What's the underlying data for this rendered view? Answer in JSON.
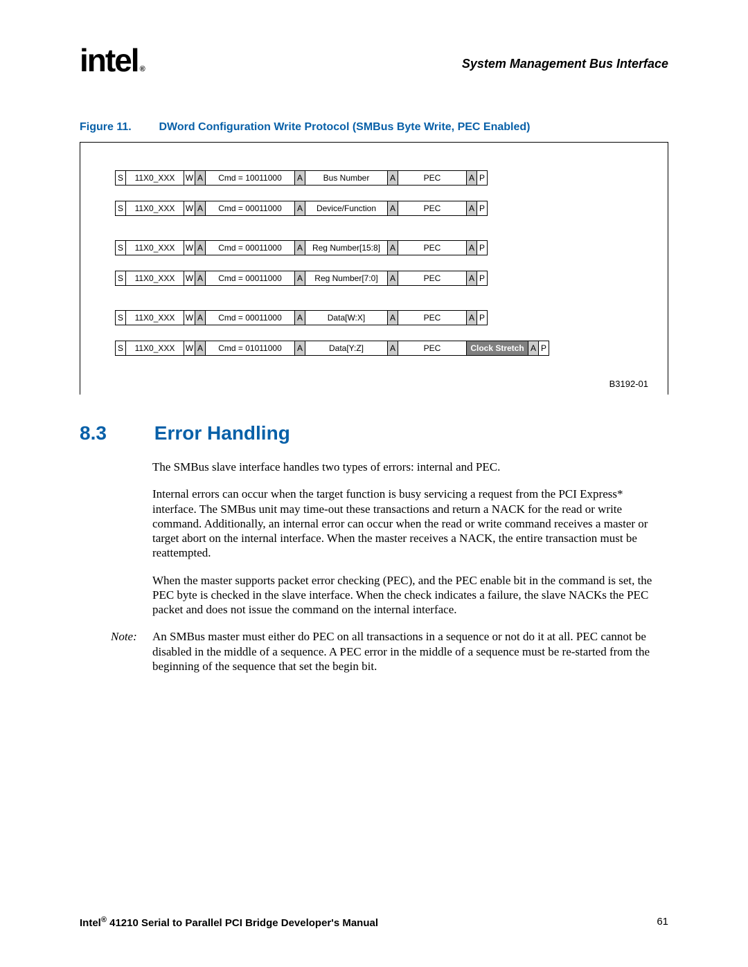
{
  "header": {
    "logo_text": "intel",
    "logo_reg": "®",
    "title": "System Management Bus Interface"
  },
  "figure": {
    "label": "Figure 11.",
    "caption": "DWord Configuration Write Protocol (SMBus Byte Write, PEC Enabled)",
    "code": "B3192-01",
    "rows": [
      {
        "s": "S",
        "addr": "11X0_XXX",
        "w": "W",
        "a1": "A",
        "cmd": "Cmd = 10011000",
        "a2": "A",
        "data": "Bus Number",
        "a3": "A",
        "pec": "PEC",
        "a4": "A",
        "p": "P",
        "gap": false,
        "stretch": false
      },
      {
        "s": "S",
        "addr": "11X0_XXX",
        "w": "W",
        "a1": "A",
        "cmd": "Cmd = 00011000",
        "a2": "A",
        "data": "Device/Function",
        "a3": "A",
        "pec": "PEC",
        "a4": "A",
        "p": "P",
        "gap": true,
        "stretch": false
      },
      {
        "s": "S",
        "addr": "11X0_XXX",
        "w": "W",
        "a1": "A",
        "cmd": "Cmd = 00011000",
        "a2": "A",
        "data": "Reg Number[15:8]",
        "a3": "A",
        "pec": "PEC",
        "a4": "A",
        "p": "P",
        "gap": false,
        "stretch": false
      },
      {
        "s": "S",
        "addr": "11X0_XXX",
        "w": "W",
        "a1": "A",
        "cmd": "Cmd = 00011000",
        "a2": "A",
        "data": "Reg Number[7:0]",
        "a3": "A",
        "pec": "PEC",
        "a4": "A",
        "p": "P",
        "gap": true,
        "stretch": false
      },
      {
        "s": "S",
        "addr": "11X0_XXX",
        "w": "W",
        "a1": "A",
        "cmd": "Cmd = 00011000",
        "a2": "A",
        "data": "Data[W:X]",
        "a3": "A",
        "pec": "PEC",
        "a4": "A",
        "p": "P",
        "gap": false,
        "stretch": false
      },
      {
        "s": "S",
        "addr": "11X0_XXX",
        "w": "W",
        "a1": "A",
        "cmd": "Cmd = 01011000",
        "a2": "A",
        "data": "Data[Y:Z]",
        "a3": "A",
        "pec": "PEC",
        "stretch_label": "Clock Stretch",
        "a4": "A",
        "p": "P",
        "gap": false,
        "stretch": true
      }
    ]
  },
  "section": {
    "number": "8.3",
    "title": "Error Handling",
    "para1": "The SMBus slave interface handles two types of errors: internal and PEC.",
    "para2": "Internal errors can occur when the target function is busy servicing a request from the PCI Express* interface. The SMBus unit may time-out these transactions and return a NACK for the read or write command. Additionally, an internal error can occur when the read or write command receives a master or target abort on the internal interface. When the master receives a NACK, the entire transaction must be reattempted.",
    "para3": "When the master supports packet error checking (PEC), and the PEC enable bit in the command is set, the PEC byte is checked in the slave interface. When the check indicates a failure, the slave NACKs the PEC packet and does not issue the command on the internal interface.",
    "note_label": "Note:",
    "note_text": "An SMBus master must either do PEC on all transactions in a sequence or not do it at all. PEC cannot be disabled in the middle of a sequence. A PEC error in the middle of a sequence must be re-started from the beginning of the sequence that set the begin bit."
  },
  "footer": {
    "brand": "Intel",
    "reg": "®",
    "title": " 41210 Serial to Parallel PCI Bridge Developer's Manual",
    "page": "61"
  }
}
